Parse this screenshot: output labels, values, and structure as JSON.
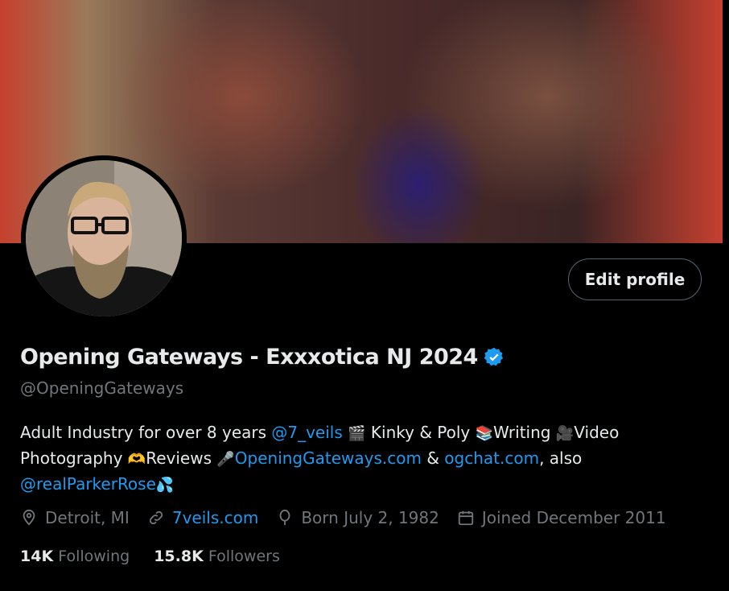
{
  "profile": {
    "display_name": "Opening Gateways - Exxxotica NJ 2024",
    "handle": "@OpeningGateways",
    "edit_label": "Edit profile",
    "bio": {
      "part1": "Adult Industry for over 8 years ",
      "mention1": "@7_veils",
      "emoji1": "🎬",
      "part2": " Kinky & Poly ",
      "emoji2": "📚",
      "part3": "Writing ",
      "emoji3": "🎥",
      "part4": "Video Photography ",
      "emoji4": "🫶",
      "part5": "Reviews ",
      "emoji5": "🎤",
      "link1": "OpeningGateways.com",
      "part6": " & ",
      "link2": "ogchat.com",
      "part7": ", also",
      "mention2": "@realParkerRose",
      "emoji6": "💦"
    },
    "location": "Detroit, MI",
    "website": "7veils.com",
    "born": "Born July 2, 1982",
    "joined": "Joined December 2011",
    "following_count": "14K",
    "following_label": " Following",
    "followers_count": "15.8K",
    "followers_label": " Followers",
    "icons": [
      "location-icon",
      "link-icon",
      "balloon-icon",
      "calendar-icon",
      "verified-badge-icon"
    ],
    "colors": {
      "accent": "#1d9bf0",
      "muted": "#71767b",
      "text": "#e7e9ea",
      "background": "#000000"
    }
  }
}
